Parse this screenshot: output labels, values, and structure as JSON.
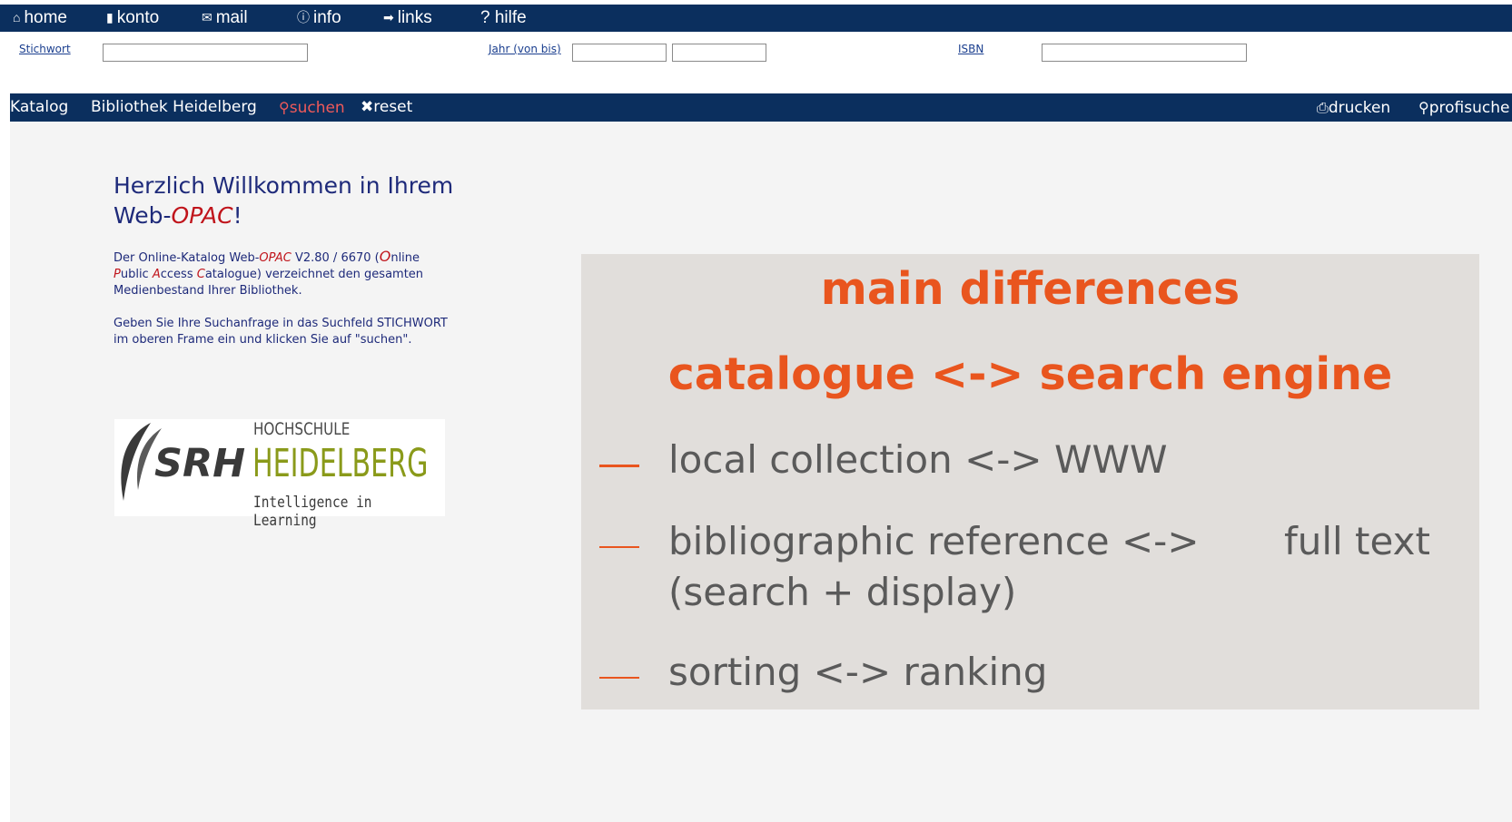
{
  "topnav": {
    "items": [
      {
        "icon": "home-icon",
        "label": "home"
      },
      {
        "icon": "account-icon",
        "label": "konto"
      },
      {
        "icon": "mail-icon",
        "label": "mail"
      },
      {
        "icon": "info-icon",
        "label": "info"
      },
      {
        "icon": "arrow-right-icon",
        "label": "links"
      },
      {
        "icon": "question-icon",
        "label": "? hilfe"
      }
    ]
  },
  "search": {
    "stichwort_label": "Stichwort",
    "stichwort_value": "",
    "jahr_label": "Jahr (von bis)",
    "jahr_von_value": "",
    "jahr_bis_value": "",
    "isbn_label": "ISBN",
    "isbn_value": ""
  },
  "katbar": {
    "katalog": "Katalog",
    "bibliothek": "Bibliothek Heidelberg",
    "suchen": "suchen",
    "reset": "reset",
    "drucken": "drucken",
    "profisuche": "profisuche"
  },
  "welcome": {
    "title_part1": "Herzlich Willkommen in Ihrem Web-",
    "title_opac": "OPAC",
    "title_end": "!",
    "p1_a": "Der Online-Katalog Web-",
    "p1_opac": "OPAC",
    "p1_b": " V2.80 / 6670 (",
    "p1_o": "O",
    "p1_c": "nline ",
    "p1_p": "P",
    "p1_d": "ublic ",
    "p1_a2": "A",
    "p1_e": "ccess ",
    "p1_cc": "C",
    "p1_f": "atalogue) verzeichnet den gesamten Medienbestand Ihrer Bibliothek.",
    "p2": "Geben Sie Ihre Suchanfrage in das Suchfeld STICHWORT im oberen Frame ein und klicken Sie auf \"suchen\"."
  },
  "logo": {
    "srh": "SRH",
    "hochschule": "HOCHSCHULE",
    "heidelberg": "HEIDELBERG",
    "tagline": "Intelligence in Learning"
  },
  "slide": {
    "heading1": "main differences",
    "heading2": "catalogue <-> search engine",
    "bullets": [
      {
        "line1": "local collection <-> WWW",
        "line2": ""
      },
      {
        "line1": "bibliographic reference <->       full text",
        "line2": "(search + display)"
      },
      {
        "line1": "sorting <-> ranking",
        "line2": ""
      }
    ]
  },
  "colors": {
    "navy": "#0b2f5e",
    "accent_orange": "#e9551e",
    "opac_red": "#c0141b",
    "link_blue": "#1b3f8f"
  }
}
